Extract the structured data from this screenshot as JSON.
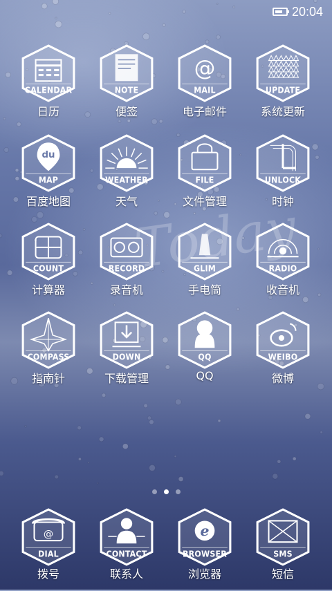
{
  "status_bar": {
    "time": "20:04",
    "battery_level": 0.7
  },
  "wallpaper": {
    "watermark_text": "Today"
  },
  "apps": [
    {
      "id": "calendar",
      "label": "日历",
      "badge": "CALENDAR",
      "icon": "calendar-icon"
    },
    {
      "id": "note",
      "label": "便签",
      "badge": "NOTE",
      "icon": "note-icon"
    },
    {
      "id": "mail",
      "label": "电子邮件",
      "badge": "MAIL",
      "icon": "mail-icon"
    },
    {
      "id": "update",
      "label": "系统更新",
      "badge": "UPDATE",
      "icon": "update-icon"
    },
    {
      "id": "map",
      "label": "百度地图",
      "badge": "MAP",
      "icon": "map-icon",
      "glyph": "du"
    },
    {
      "id": "weather",
      "label": "天气",
      "badge": "WEATHER",
      "icon": "weather-icon"
    },
    {
      "id": "file",
      "label": "文件管理",
      "badge": "FILE",
      "icon": "file-icon"
    },
    {
      "id": "unlock",
      "label": "时钟",
      "badge": "UNLOCK",
      "icon": "clock-icon"
    },
    {
      "id": "count",
      "label": "计算器",
      "badge": "COUNT",
      "icon": "calculator-icon"
    },
    {
      "id": "record",
      "label": "录音机",
      "badge": "RECORD",
      "icon": "recorder-icon"
    },
    {
      "id": "glim",
      "label": "手电筒",
      "badge": "GLIM",
      "icon": "flashlight-icon"
    },
    {
      "id": "radio",
      "label": "收音机",
      "badge": "RADIO",
      "icon": "radio-icon"
    },
    {
      "id": "compass",
      "label": "指南针",
      "badge": "COMPASS",
      "icon": "compass-icon"
    },
    {
      "id": "down",
      "label": "下载管理",
      "badge": "DOWN",
      "icon": "download-icon"
    },
    {
      "id": "qq",
      "label": "QQ",
      "badge": "QQ",
      "icon": "qq-icon"
    },
    {
      "id": "weibo",
      "label": "微博",
      "badge": "WEIBO",
      "icon": "weibo-icon"
    }
  ],
  "pager": {
    "count": 3,
    "active": 1
  },
  "dock": [
    {
      "id": "dial",
      "label": "拨号",
      "badge": "DIAL",
      "icon": "phone-icon"
    },
    {
      "id": "contact",
      "label": "联系人",
      "badge": "CONTACT",
      "icon": "contact-icon"
    },
    {
      "id": "browser",
      "label": "浏览器",
      "badge": "BROWSER",
      "icon": "browser-icon",
      "glyph": "e"
    },
    {
      "id": "sms",
      "label": "短信",
      "badge": "SMS",
      "icon": "sms-icon"
    }
  ]
}
